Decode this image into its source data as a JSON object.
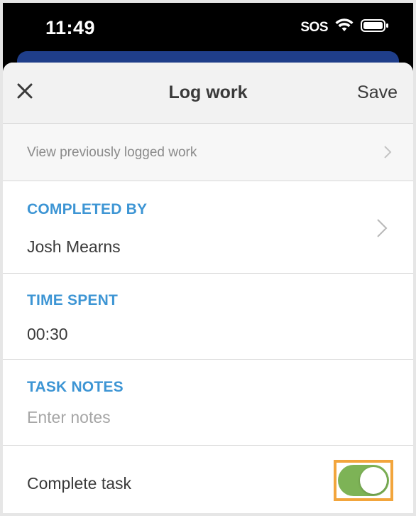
{
  "status_bar": {
    "time": "11:49",
    "sos": "SOS",
    "icons": [
      "wifi-icon",
      "battery-icon"
    ]
  },
  "nav": {
    "close_icon": "close-icon",
    "title": "Log work",
    "save_label": "Save"
  },
  "view_previous": {
    "label": "View previously logged work",
    "icon": "chevron-right-icon"
  },
  "completed_by": {
    "label": "COMPLETED BY",
    "value": "Josh Mearns",
    "icon": "chevron-right-icon"
  },
  "time_spent": {
    "label": "TIME SPENT",
    "value": "00:30"
  },
  "task_notes": {
    "label": "TASK NOTES",
    "value": "",
    "placeholder": "Enter notes"
  },
  "complete_task": {
    "label": "Complete task",
    "enabled": true
  },
  "colors": {
    "accent_label": "#3d95d4",
    "toggle_on": "#7db356",
    "highlight": "#f2a53c",
    "header_behind": "#1f3e8a"
  }
}
